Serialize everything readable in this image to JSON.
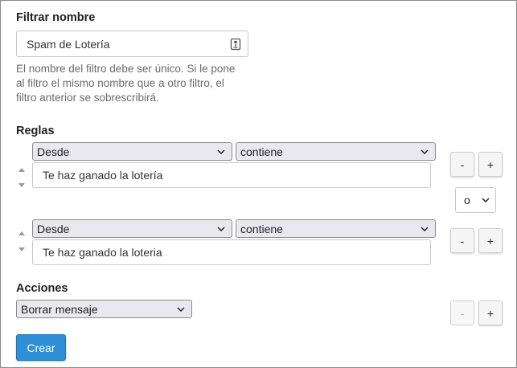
{
  "filter_name": {
    "label": "Filtrar nombre",
    "value": "Spam de Lotería",
    "help": "El nombre del filtro debe ser único. Si le pone al filtro el mismo nombre que a otro filtro, el filtro anterior se sobrescribirá."
  },
  "rules": {
    "label": "Reglas",
    "items": [
      {
        "field": "Desde",
        "operator": "contiene",
        "value": "Te haz ganado la lotería",
        "remove": "-",
        "add": "+"
      },
      {
        "field": "Desde",
        "operator": "contiene",
        "value": "Te haz ganado la loteria",
        "remove": "-",
        "add": "+"
      }
    ],
    "conjunction": "o"
  },
  "actions": {
    "label": "Acciones",
    "items": [
      {
        "action": "Borrar mensaje",
        "remove": "-",
        "add": "+"
      }
    ]
  },
  "submit_label": "Crear"
}
